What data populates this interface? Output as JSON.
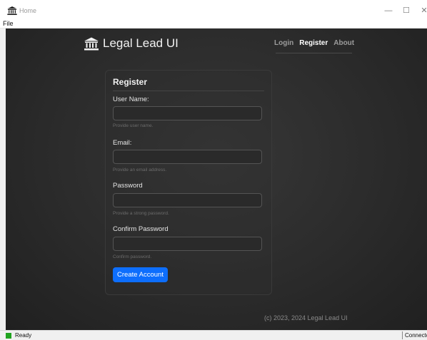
{
  "window": {
    "title": "Home",
    "menu": [
      "File"
    ]
  },
  "header": {
    "brand": "Legal Lead UI",
    "nav": [
      {
        "label": "Login",
        "active": false
      },
      {
        "label": "Register",
        "active": true
      },
      {
        "label": "About",
        "active": false
      }
    ]
  },
  "form": {
    "title": "Register",
    "fields": [
      {
        "label": "User Name:",
        "value": "",
        "hint": "Provide user name."
      },
      {
        "label": "Email:",
        "value": "",
        "hint": "Provide an email address."
      },
      {
        "label": "Password",
        "value": "",
        "hint": "Provide a strong password."
      },
      {
        "label": "Confirm Password",
        "value": "",
        "hint": "Confirm password."
      }
    ],
    "submit_label": "Create Account"
  },
  "footer": {
    "text": "(c) 2023, 2024 Legal Lead UI"
  },
  "statusbar": {
    "status": "Ready",
    "connection": "Connected"
  },
  "colors": {
    "accent": "#0d6efd",
    "background": "#2b2b2b",
    "status_ok": "#1fa31f"
  }
}
